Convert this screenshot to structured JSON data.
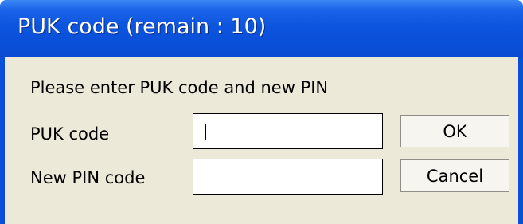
{
  "window": {
    "title": "PUK code (remain : 10)"
  },
  "dialog": {
    "instruction": "Please enter PUK code and new PIN",
    "puk_label": "PUK code",
    "puk_value": "",
    "new_pin_label": "New PIN code",
    "new_pin_value": "",
    "ok_label": "OK",
    "cancel_label": "Cancel"
  },
  "colors": {
    "titlebar": "#0A4FD8",
    "client_background": "#ECE9D8",
    "title_text": "#FFFFFF"
  }
}
